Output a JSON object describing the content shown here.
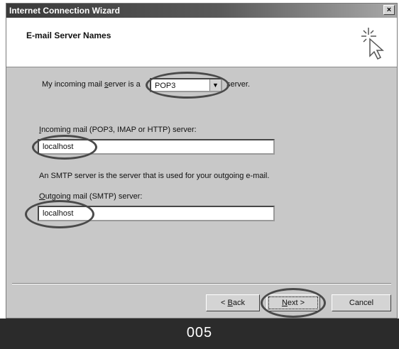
{
  "window": {
    "title": "Internet Connection Wizard",
    "close_label": "×"
  },
  "header": {
    "title": "E-mail Server Names"
  },
  "incoming_type": {
    "prefix": "My incoming mail ",
    "prefix_u": "s",
    "prefix_rest": "erver is a",
    "selected": "POP3",
    "suffix": "server."
  },
  "incoming_server": {
    "label_u": "I",
    "label_rest": "ncoming mail (POP3, IMAP or HTTP) server:",
    "value": "localhost"
  },
  "smtp_info": "An SMTP server is the server that is used for your outgoing e-mail.",
  "outgoing_server": {
    "label_u": "O",
    "label_rest": "utgoing mail (SMTP) server:",
    "value": "localhost"
  },
  "buttons": {
    "back_prefix": "< ",
    "back_u": "B",
    "back_rest": "ack",
    "next_u": "N",
    "next_rest": "ext >",
    "cancel": "Cancel"
  },
  "footer": {
    "label": "005"
  }
}
